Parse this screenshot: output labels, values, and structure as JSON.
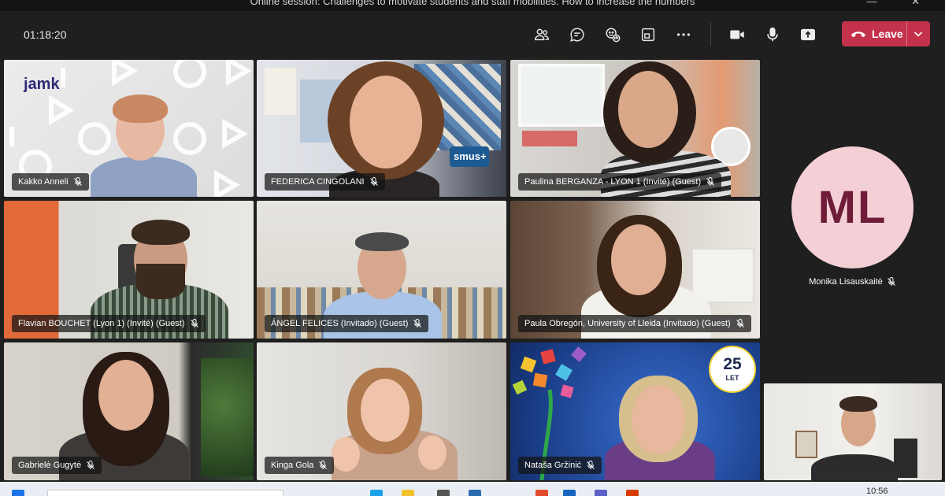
{
  "window": {
    "title": "Online session: Challenges to motivate students and staff mobilities. How to increase the numbers",
    "controls": "— ✕"
  },
  "toolbar": {
    "timer": "01:18:20",
    "icons": [
      "people-icon",
      "chat-icon",
      "reactions-icon",
      "rooms-icon",
      "more-icon",
      "camera-icon",
      "mic-icon",
      "share-icon"
    ],
    "leave_label": "Leave",
    "leave_color": "#c4314b"
  },
  "participants": [
    {
      "name": "Kakko Anneli",
      "logo": "jamk"
    },
    {
      "name": "FEDERICA CINGOLANI",
      "poster": "smus+"
    },
    {
      "name": "Paulina BERGANZA - LYON 1 (Invité) (Guest)"
    },
    {
      "name": "Flavian BOUCHET (Lyon 1) (Invité) (Guest)"
    },
    {
      "name": "ÁNGEL FELICES (Invitado) (Guest)"
    },
    {
      "name": "Paula Obregón, University of Lleida (Invitado) (Guest)"
    },
    {
      "name": "Gabrielė Gugytė"
    },
    {
      "name": "Kinga Gola"
    },
    {
      "name": "Nataša Gržinić",
      "badge_number": "25",
      "badge_text": "LET"
    }
  ],
  "side": {
    "initials": "ML",
    "name": "Monika Lisauskaitė",
    "avatar_bg": "#f5cfd6",
    "avatar_fg": "#6e1c38"
  },
  "taskbar": {
    "clock": "10:56"
  }
}
